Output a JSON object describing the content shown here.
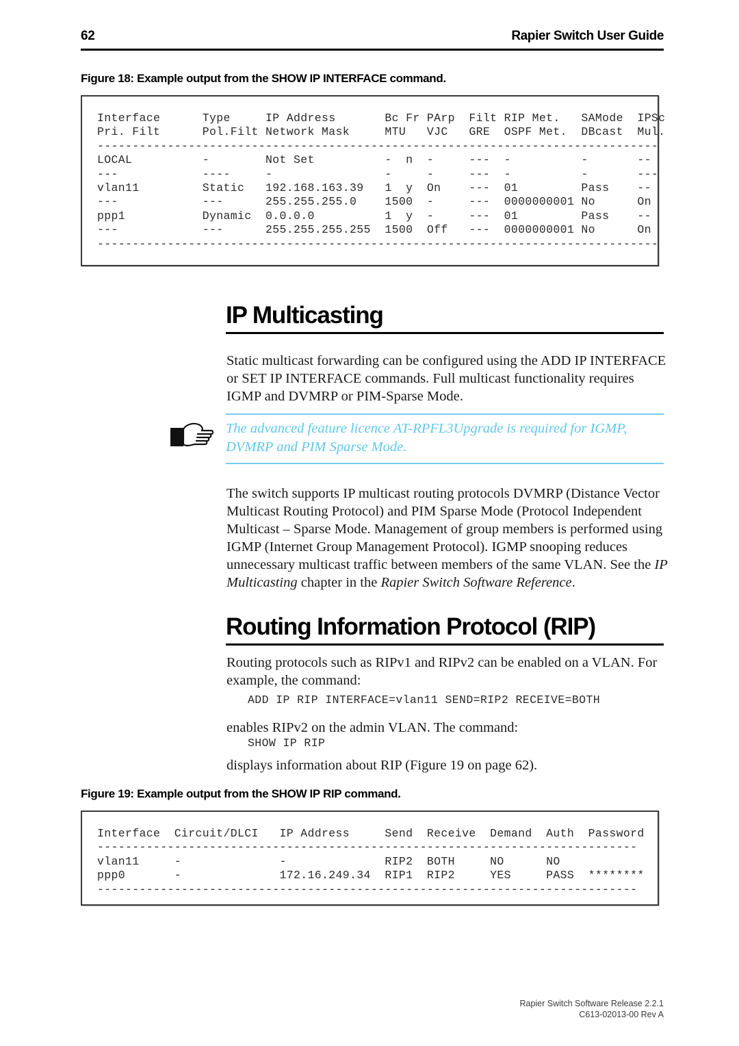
{
  "header": {
    "page_number": "62",
    "title": "Rapier Switch User Guide"
  },
  "figure18": {
    "caption": "Figure 18: Example output from the SHOW IP INTERFACE command.",
    "output": "Interface      Type     IP Address       Bc Fr PArp  Filt RIP Met.   SAMode  IPSc\nPri. Filt      Pol.Filt Network Mask     MTU   VJC   GRE  OSPF Met.  DBcast  Mul.\n--------------------------------------------------------------------------------\nLOCAL          -        Not Set          -  n  -     ---  -          -       --\n---            ----     -                -     -     ---  -          -       ---\nvlan11         Static   192.168.163.39   1  y  On    ---  01         Pass    --\n---            ---      255.255.255.0    1500  -     ---  0000000001 No      On\nppp1           Dynamic  0.0.0.0          1  y  -     ---  01         Pass    --\n---            ---      255.255.255.255  1500  Off   ---  0000000001 No      On\n--------------------------------------------------------------------------------"
  },
  "multicasting": {
    "heading": "IP Multicasting",
    "paragraph1": "Static multicast forwarding can be configured using the ADD IP INTERFACE or SET IP INTERFACE commands. Full multicast functionality requires IGMP and DVMRP or PIM-Sparse Mode.",
    "note": "The advanced feature licence AT-RPFL3Upgrade is required for IGMP, DVMRP and PIM Sparse Mode.",
    "note_icon": "pointing-hand-icon",
    "note_color": "#5fc8ea",
    "paragraph2_part1": "The switch supports IP multicast routing protocols DVMRP (Distance Vector Multicast Routing Protocol) and PIM Sparse Mode (Protocol Independent Multicast – Sparse Mode. Management of group members is performed using IGMP (Internet Group Management Protocol). IGMP snooping reduces unnecessary multicast traffic between members of the same VLAN. See the ",
    "paragraph2_em1": "IP Multicasting",
    "paragraph2_part2": " chapter in the ",
    "paragraph2_em2": "Rapier Switch Software Reference",
    "paragraph2_part3": "."
  },
  "rip": {
    "heading": "Routing Information Protocol (RIP)",
    "paragraph1": "Routing protocols such as RIPv1 and RIPv2 can be enabled on a VLAN. For example, the command:",
    "command1": "ADD IP RIP INTERFACE=vlan11 SEND=RIP2 RECEIVE=BOTH",
    "paragraph2": "enables RIPv2 on the admin VLAN. The command:",
    "command2": "SHOW IP RIP",
    "paragraph3": "displays information about RIP (Figure 19 on page 62)."
  },
  "figure19": {
    "caption": "Figure 19: Example output from the SHOW IP RIP command.",
    "output": "Interface  Circuit/DLCI   IP Address     Send  Receive  Demand  Auth  Password\n-----------------------------------------------------------------------------\nvlan11     -              -              RIP2  BOTH     NO      NO\nppp0       -              172.16.249.34  RIP1  RIP2     YES     PASS  ********\n-----------------------------------------------------------------------------"
  },
  "footer": {
    "line1": "Rapier Switch Software Release 2.2.1",
    "line2": "C613-02013-00 Rev A"
  }
}
